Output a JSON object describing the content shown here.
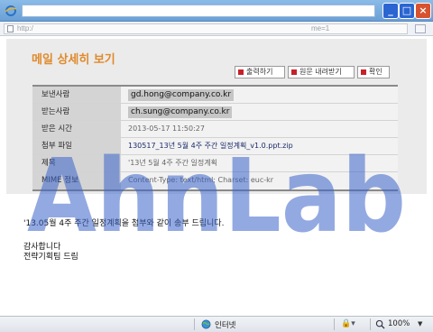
{
  "browser": {
    "address_prefix": "http:/",
    "address_suffix": "me=1",
    "status_zone": "인터넷",
    "zoom": "100%"
  },
  "page": {
    "title": "메일 상세히 보기",
    "actions": [
      "출력하기",
      "원문 내려받기",
      "확인"
    ]
  },
  "mail": {
    "rows": [
      {
        "label": "보낸사람",
        "value": "gd.hong@company.co.kr"
      },
      {
        "label": "받는사람",
        "value": "ch.sung@company.co.kr"
      },
      {
        "label": "받은 시간",
        "value": "2013-05-17 11:50:27"
      },
      {
        "label": "첨부 파일",
        "value": "130517_13년 5월 4주 주간 일정계획_v1.0.ppt.zip"
      },
      {
        "label": "제목",
        "value": "'13년 5월 4주 주간 일정계획"
      },
      {
        "label": "MIME 정보",
        "value": "Content-Type: text/html; Charset: euc-kr"
      }
    ],
    "body_lines": [
      "'13.05월 4주 주간 일정계획을 첨부와 같이 송부 드립니다.",
      "감사합니다",
      "전략기획팀 드림"
    ]
  },
  "watermark": {
    "text": "AhnLab",
    "color": "#3b63c8"
  }
}
